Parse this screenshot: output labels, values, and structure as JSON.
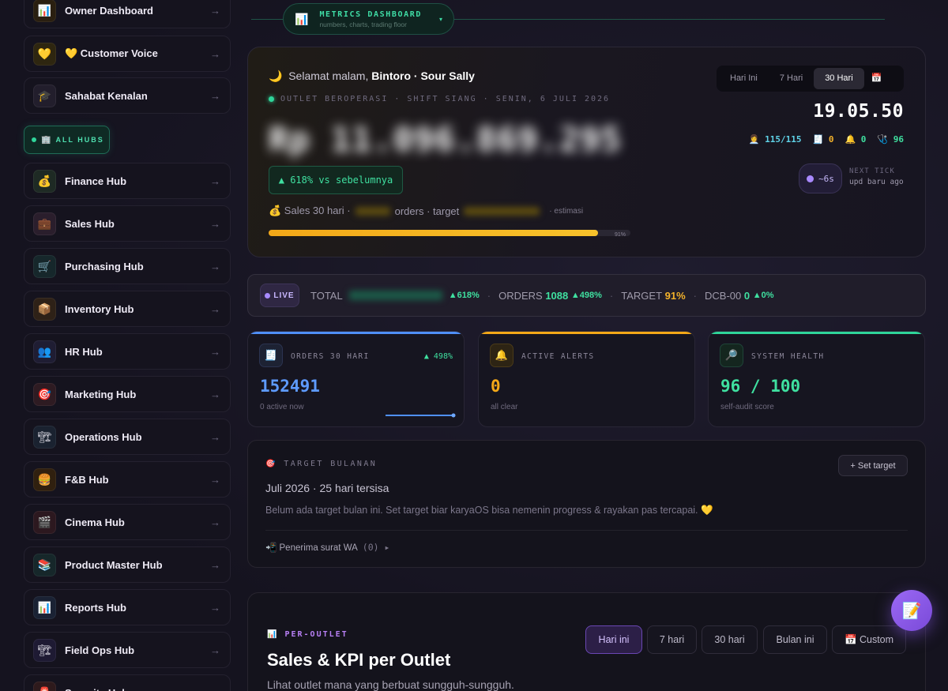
{
  "sidebar": {
    "items": [
      {
        "label": "Owner Dashboard",
        "icon": "📊",
        "iconBg": "#2a1f10"
      },
      {
        "label": "💛 Customer Voice",
        "icon": "💛",
        "iconBg": "#2e2610"
      },
      {
        "label": "Sahabat Kenalan",
        "icon": "🎓",
        "iconBg": "#221e2c"
      },
      {
        "label": "Finance Hub",
        "icon": "💰",
        "iconBg": "#1e2a24"
      },
      {
        "label": "Sales Hub",
        "icon": "💼",
        "iconBg": "#2a1e2c"
      },
      {
        "label": "Purchasing Hub",
        "icon": "🛒",
        "iconBg": "#16272b"
      },
      {
        "label": "Inventory Hub",
        "icon": "📦",
        "iconBg": "#2e2117"
      },
      {
        "label": "HR Hub",
        "icon": "👥",
        "iconBg": "#1f1d33"
      },
      {
        "label": "Marketing Hub",
        "icon": "🎯",
        "iconBg": "#2e1b22"
      },
      {
        "label": "Operations Hub",
        "icon": "🏗",
        "iconBg": "#1a2230"
      },
      {
        "label": "F&B Hub",
        "icon": "🍔",
        "iconBg": "#30200f"
      },
      {
        "label": "Cinema Hub",
        "icon": "🎬",
        "iconBg": "#2c181f"
      },
      {
        "label": "Product Master Hub",
        "icon": "📚",
        "iconBg": "#16272a"
      },
      {
        "label": "Reports Hub",
        "icon": "📊",
        "iconBg": "#1a2234"
      },
      {
        "label": "Field Ops Hub",
        "icon": "🏗",
        "iconBg": "#1e1a33"
      },
      {
        "label": "Security Hub",
        "icon": "🚨",
        "iconBg": "#2e1a1c"
      }
    ],
    "all_hubs_label": "ALL HUBS",
    "arrow": "→"
  },
  "metrics_pill": {
    "title": "METRICS DASHBOARD",
    "subtitle": "numbers, charts, trading floor",
    "icon": "📊",
    "caret": "▾"
  },
  "hero": {
    "greeting_prefix": "Selamat malam, ",
    "greeting_name": "Bintoro · Sour Sally",
    "moon": "🌙",
    "status": "OUTLET BEROPERASI · SHIFT SIANG · SENIN, 6 JULI 2026",
    "amount": "Rp 11.096.869.295",
    "delta": "▲ 618% vs sebelumnya",
    "sales_prefix": "💰 Sales 30 hari ·",
    "sales_mid": "orders · target",
    "sales_suffix": "· estimasi",
    "progress_pct": 91,
    "progress_label": "91%",
    "ranges": [
      "Hari Ini",
      "7 Hari",
      "30 Hari"
    ],
    "active_range": "30 Hari",
    "calendar_icon": "📅",
    "clock": "19.05.50",
    "kpi_staff": "115/115",
    "kpi_orders": "0",
    "kpi_alerts": "0",
    "kpi_health": "96",
    "tick_value": "~6s",
    "tick_label": "NEXT TICK",
    "tick_sub": "upd baru ago"
  },
  "ticker": {
    "live": "LIVE",
    "total_label": "TOTAL",
    "total_delta": "▲618%",
    "orders_label": "ORDERS",
    "orders_value": "1088",
    "orders_delta": "▲498%",
    "target_label": "TARGET",
    "target_value": "91%",
    "dcb_label": "DCB-00",
    "dcb_value": "0",
    "dcb_delta": "▲0%",
    "sep": "·"
  },
  "stats": [
    {
      "label": "ORDERS 30 HARI",
      "value": "152491",
      "sub": "0 active now",
      "delta": "▲ 498%",
      "icon": "🧾",
      "color": "#4f8ff7"
    },
    {
      "label": "ACTIVE ALERTS",
      "value": "0",
      "sub": "all clear",
      "icon": "🔔",
      "color": "#f3a818"
    },
    {
      "label": "SYSTEM HEALTH",
      "value": "96 / 100",
      "sub": "self-audit score",
      "icon": "🔎",
      "color": "#2fd59a"
    }
  ],
  "target": {
    "label": "🎯 TARGET BULANAN",
    "month": "Juli 2026 · 25 hari tersisa",
    "desc": "Belum ada target bulan ini. Set target biar karyaOS bisa nemenin progress & rayakan pas tercapai. 💛",
    "wa": "📲 Penerima surat WA",
    "wa_count": "(0) ▸",
    "button": "+ Set target"
  },
  "outlet": {
    "label": "📊  PER-OUTLET",
    "title": "Sales & KPI per Outlet",
    "subtitle": "Lihat outlet mana yang berbuat sungguh-sungguh.",
    "periods": [
      "Hari ini",
      "7 hari",
      "30 hari",
      "Bulan ini",
      "📅 Custom"
    ],
    "active_period": "Hari ini"
  },
  "fab": {
    "icon": "📝"
  }
}
